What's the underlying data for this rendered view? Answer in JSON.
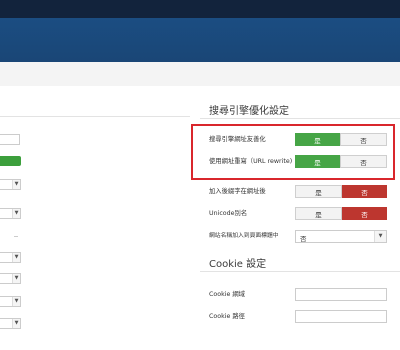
{
  "seo_section": {
    "title": "搜尋引擎優化設定",
    "rows": [
      {
        "label": "搜尋引擎網址友善化",
        "yes": "是",
        "no": "否",
        "selected": "yes"
      },
      {
        "label": "使用網址重寫（URL rewrite)",
        "yes": "是",
        "no": "否",
        "selected": "yes"
      },
      {
        "label": "加入後綴字在網址後",
        "yes": "是",
        "no": "否",
        "selected": "no"
      },
      {
        "label": "Unicode別名",
        "yes": "是",
        "no": "否",
        "selected": "no"
      }
    ],
    "sitename_label": "網站名稱加入到頁面標題中",
    "sitename_value": "否"
  },
  "cookie_section": {
    "title": "Cookie 設定",
    "domain_label": "Cookie 網域",
    "path_label": "Cookie 路徑",
    "domain_value": "",
    "path_value": ""
  },
  "colors": {
    "header_dark": "#12233c",
    "header_blue": "#1b4d82",
    "yes_active": "#46a546",
    "no_active": "#bd362f",
    "highlight_border": "#d9262c"
  }
}
